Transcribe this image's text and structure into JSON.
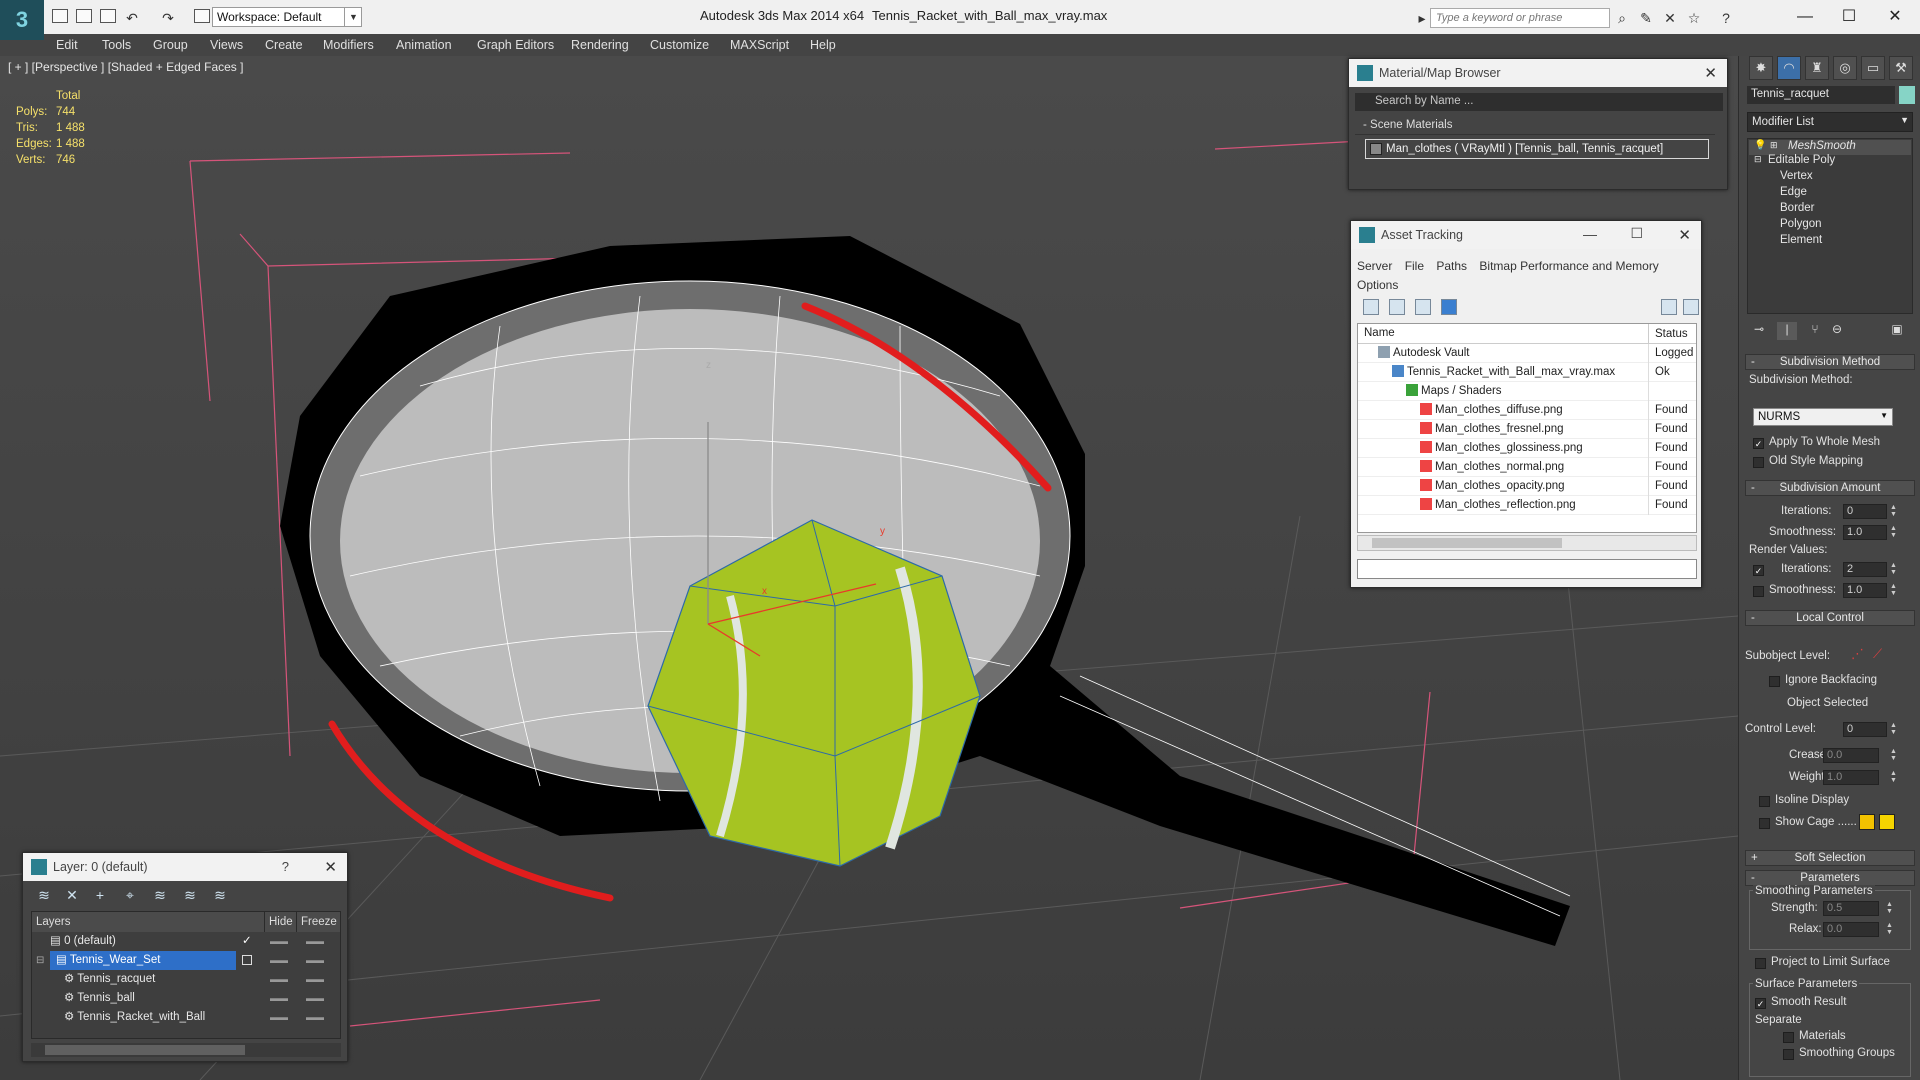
{
  "window": {
    "app_title": "Autodesk 3ds Max  2014 x64",
    "file_title": "Tennis_Racket_with_Ball_max_vray.max",
    "workspace": "Workspace: Default",
    "search_placeholder": "Type a keyword or phrase"
  },
  "menu": [
    "Edit",
    "Tools",
    "Group",
    "Views",
    "Create",
    "Modifiers",
    "Animation",
    "Graph Editors",
    "Rendering",
    "Customize",
    "MAXScript",
    "Help"
  ],
  "viewport": {
    "label": "[ + ] [Perspective ] [Shaded + Edged Faces ]",
    "stats": {
      "header": "Total",
      "rows": [
        {
          "label": "Polys:",
          "value": "744"
        },
        {
          "label": "Tris:",
          "value": "1 488"
        },
        {
          "label": "Edges:",
          "value": "1 488"
        },
        {
          "label": "Verts:",
          "value": "746"
        }
      ]
    },
    "gizmo_labels": {
      "z": "z",
      "y": "y",
      "x": "x"
    }
  },
  "material_browser": {
    "title": "Material/Map Browser",
    "search": "Search by Name ...",
    "group": "Scene Materials",
    "item": "Man_clothes  ( VRayMtl )  [Tennis_ball, Tennis_racquet]"
  },
  "asset_tracking": {
    "title": "Asset Tracking",
    "menu1": [
      "Server",
      "File",
      "Paths",
      "Bitmap Performance and Memory"
    ],
    "menu2": "Options",
    "col_name": "Name",
    "col_status": "Status",
    "rows": [
      {
        "name": "Autodesk Vault",
        "status": "Logged Ou",
        "indent": 0
      },
      {
        "name": "Tennis_Racket_with_Ball_max_vray.max",
        "status": "Ok",
        "indent": 1
      },
      {
        "name": "Maps / Shaders",
        "status": "",
        "indent": 2
      },
      {
        "name": "Man_clothes_diffuse.png",
        "status": "Found",
        "indent": 3
      },
      {
        "name": "Man_clothes_fresnel.png",
        "status": "Found",
        "indent": 3
      },
      {
        "name": "Man_clothes_glossiness.png",
        "status": "Found",
        "indent": 3
      },
      {
        "name": "Man_clothes_normal.png",
        "status": "Found",
        "indent": 3
      },
      {
        "name": "Man_clothes_opacity.png",
        "status": "Found",
        "indent": 3
      },
      {
        "name": "Man_clothes_reflection.png",
        "status": "Found",
        "indent": 3
      }
    ]
  },
  "layers": {
    "title": "Layer: 0 (default)",
    "help": "?",
    "col_layers": "Layers",
    "col_hide": "Hide",
    "col_freeze": "Freeze",
    "rows": [
      {
        "name": "0 (default)",
        "indent": 1,
        "selected": false
      },
      {
        "name": "Tennis_Wear_Set",
        "indent": 1,
        "selected": true
      },
      {
        "name": "Tennis_racquet",
        "indent": 2,
        "selected": false
      },
      {
        "name": "Tennis_ball",
        "indent": 2,
        "selected": false
      },
      {
        "name": "Tennis_Racket_with_Ball",
        "indent": 2,
        "selected": false
      }
    ]
  },
  "command_panel": {
    "object_name": "Tennis_racquet",
    "modifier_list": "Modifier List",
    "stack": {
      "top": "MeshSmooth",
      "base": "Editable Poly",
      "subs": [
        "Vertex",
        "Edge",
        "Border",
        "Polygon",
        "Element"
      ]
    },
    "subdivision_method": {
      "title": "Subdivision Method",
      "label": "Subdivision Method:",
      "value": "NURMS",
      "apply_whole": "Apply To Whole Mesh",
      "old_style": "Old Style Mapping"
    },
    "subdivision_amount": {
      "title": "Subdivision Amount",
      "iterations_label": "Iterations:",
      "iterations": "0",
      "smoothness_label": "Smoothness:",
      "smoothness": "1.0",
      "render_values": "Render Values:",
      "r_iterations_label": "Iterations:",
      "r_iterations": "2",
      "r_smoothness_label": "Smoothness:",
      "r_smoothness": "1.0"
    },
    "local_control": {
      "title": "Local Control",
      "subobject_level": "Subobject Level:",
      "ignore_backfacing": "Ignore Backfacing",
      "object_selected": "Object Selected",
      "control_level_label": "Control Level:",
      "control_level": "0",
      "crease_label": "Crease:",
      "crease": "0.0",
      "weight_label": "Weight:",
      "weight": "1.0",
      "isoline": "Isoline Display",
      "show_cage": "Show Cage ......"
    },
    "soft_selection": "Soft Selection",
    "parameters": {
      "title": "Parameters",
      "smoothing_params": "Smoothing Parameters",
      "strength_label": "Strength:",
      "strength": "0.5",
      "relax_label": "Relax:",
      "relax": "0.0",
      "project": "Project to Limit Surface",
      "surface_params": "Surface Parameters",
      "smooth_result": "Smooth Result",
      "separate": "Separate",
      "materials": "Materials",
      "smoothing_groups": "Smoothing Groups"
    },
    "cage_colors": [
      "#f2c200",
      "#f5d400"
    ]
  }
}
